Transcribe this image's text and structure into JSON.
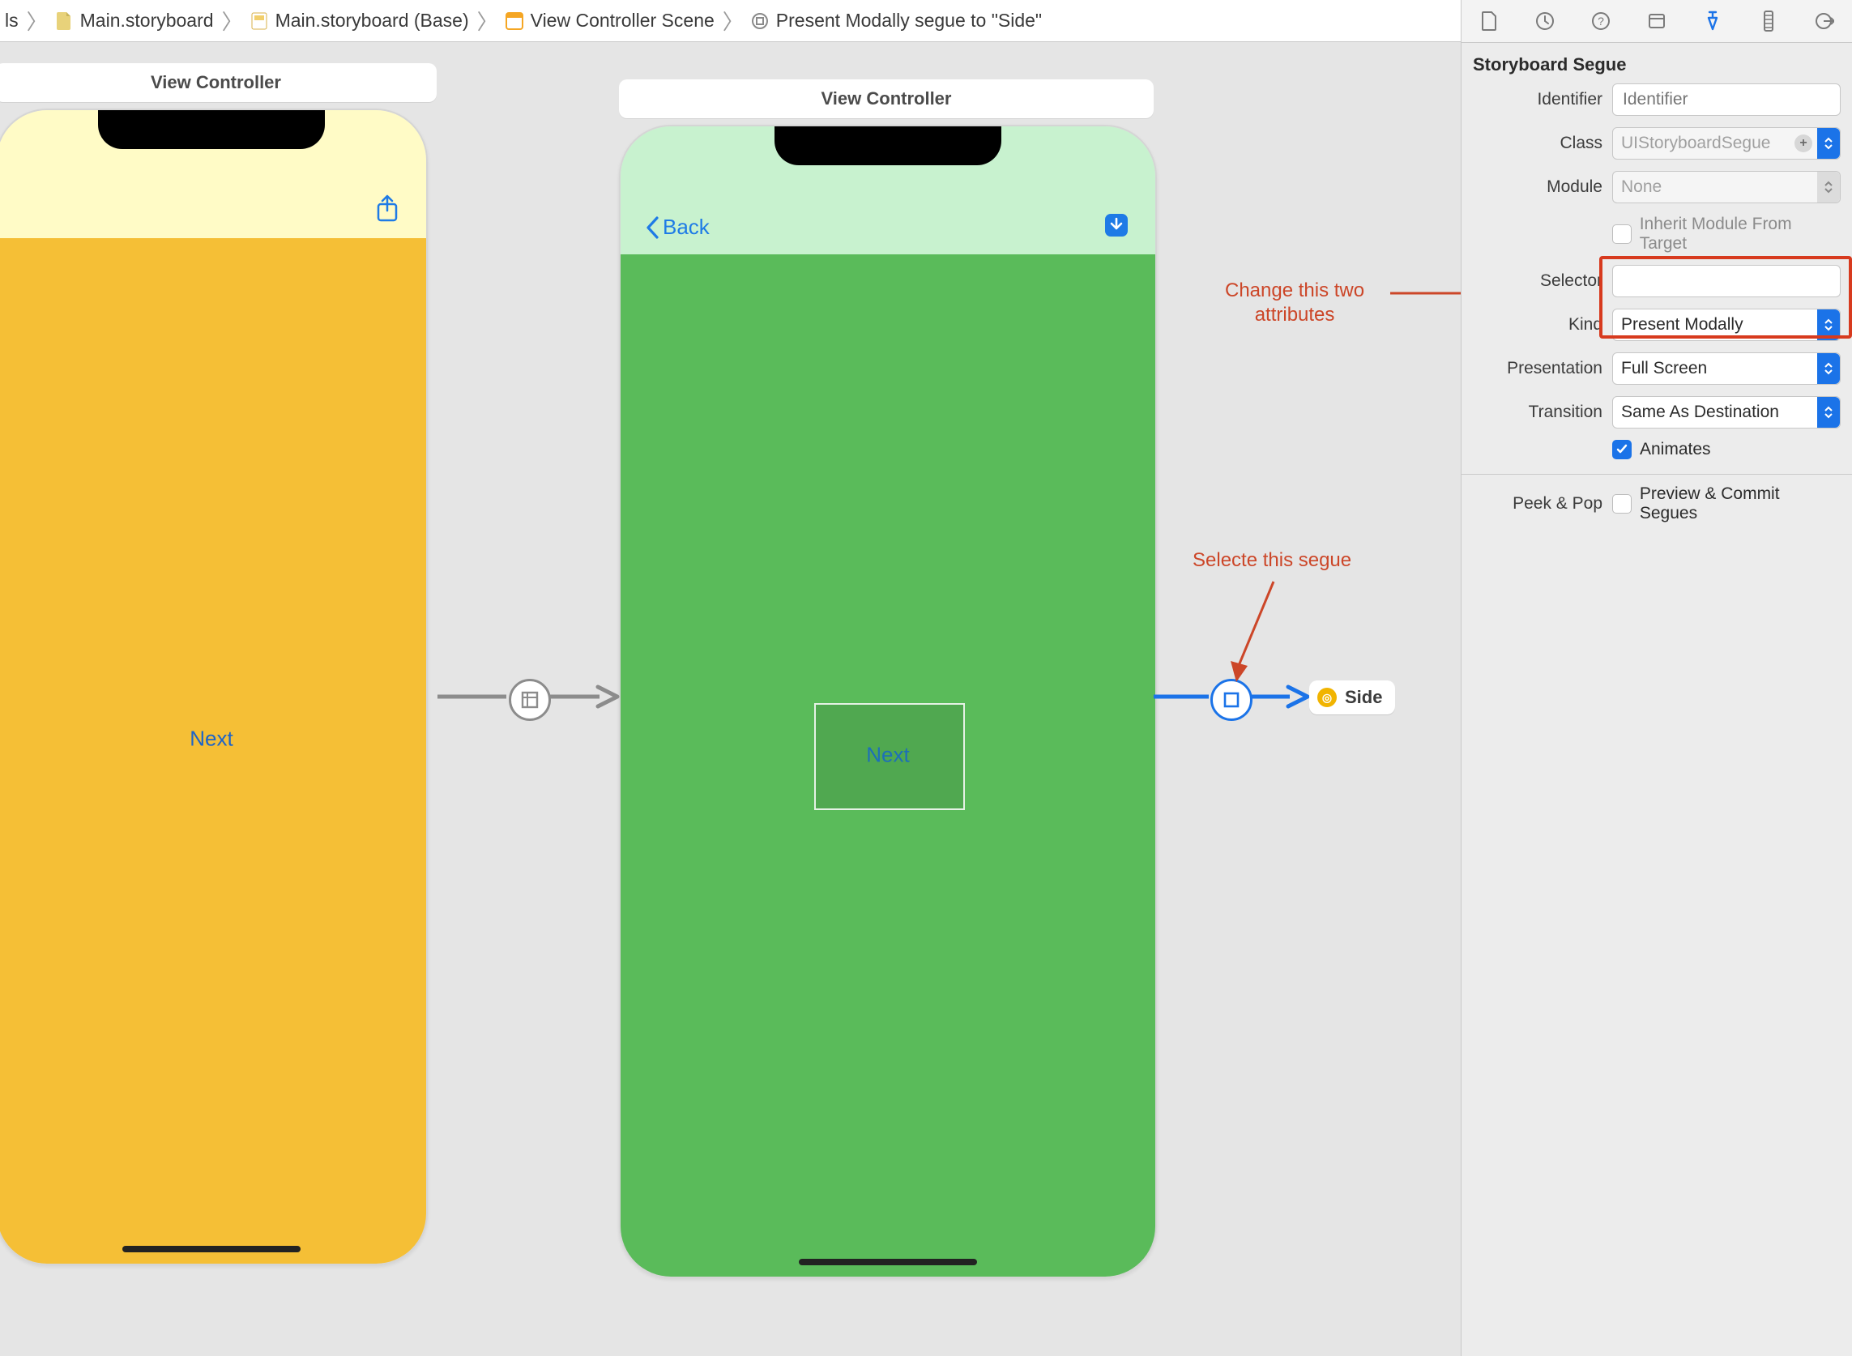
{
  "breadcrumbs": {
    "item0": "ls",
    "item1": "Main.storyboard",
    "item2": "Main.storyboard (Base)",
    "item3": "View Controller Scene",
    "item4": "Present Modally segue to \"Side\""
  },
  "canvas": {
    "vc1_title": "View Controller",
    "vc2_title": "View Controller",
    "vc1_button": "Next",
    "vc2_back": "Back",
    "vc2_button": "Next",
    "side_chip": "Side"
  },
  "annotations": {
    "attr_line1": "Change this two",
    "attr_line2": "attributes",
    "segue": "Selecte this segue"
  },
  "inspector": {
    "section": "Storyboard Segue",
    "labels": {
      "identifier": "Identifier",
      "klass": "Class",
      "module_lbl": "Module",
      "inherit": "Inherit Module From Target",
      "selector": "Selector",
      "kind": "Kind",
      "presentation": "Presentation",
      "transition": "Transition",
      "animates": "Animates",
      "peekpop": "Peek & Pop",
      "preview": "Preview & Commit Segues"
    },
    "values": {
      "identifier_ph": "Identifier",
      "klass_ph": "UIStoryboardSegue",
      "module_ph": "None",
      "kind": "Present Modally",
      "presentation": "Full Screen",
      "transition": "Same As Destination"
    }
  }
}
